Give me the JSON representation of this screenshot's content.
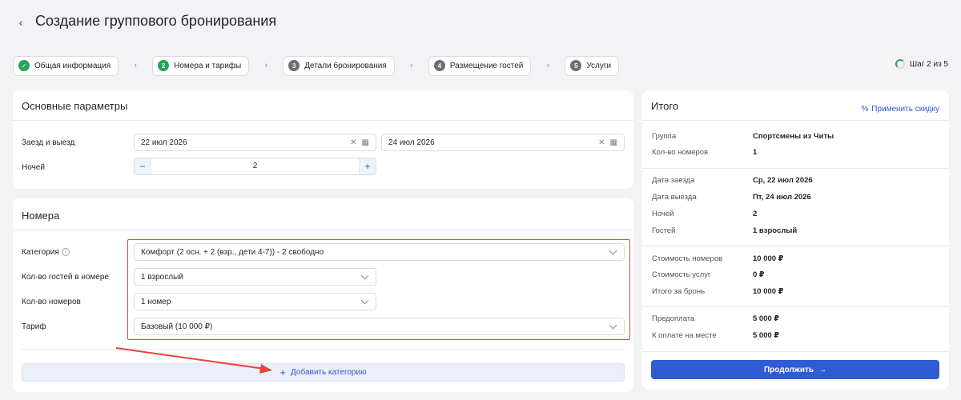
{
  "header": {
    "title": "Создание группового бронирования"
  },
  "steps": [
    {
      "num": "✓",
      "label": "Общая информация"
    },
    {
      "num": "2",
      "label": "Номера и тарифы"
    },
    {
      "num": "3",
      "label": "Детали бронирования"
    },
    {
      "num": "4",
      "label": "Размещение гостей"
    },
    {
      "num": "5",
      "label": "Услуги"
    }
  ],
  "step_counter": "Шаг 2 из 5",
  "params": {
    "title": "Основные параметры",
    "dates_label": "Заезд и выезд",
    "checkin": "22 июл 2026",
    "checkout": "24 июл 2026",
    "nights_label": "Ночей",
    "nights": "2"
  },
  "rooms": {
    "title": "Номера",
    "category_label": "Категория",
    "category_value": "Комфорт (2 осн. + 2 (взр., дети 4-7)) - 2 свободно",
    "guests_label": "Кол-во гостей в номере",
    "guests_value": "1 взрослый",
    "rooms_label": "Кол-во номеров",
    "rooms_value": "1 номер",
    "tariff_label": "Тариф",
    "tariff_value": "Базовый (10 000 ₽)",
    "add_category": "Добавить категорию"
  },
  "summary": {
    "title": "Итого",
    "apply_discount": "Применить скидку",
    "rows": [
      {
        "label": "Группа",
        "value": "Спортсмены из Читы"
      },
      {
        "label": "Кол-во номеров",
        "value": "1"
      },
      {
        "label": "Дата заезда",
        "value": "Ср, 22 июл 2026"
      },
      {
        "label": "Дата выезда",
        "value": "Пт, 24 июл 2026"
      },
      {
        "label": "Ночей",
        "value": "2"
      },
      {
        "label": "Гостей",
        "value": "1 взрослый"
      },
      {
        "label": "Стоимость номеров",
        "value": "10 000 ₽"
      },
      {
        "label": "Стоимость услуг",
        "value": "0 ₽"
      },
      {
        "label": "Итого за бронь",
        "value": "10 000 ₽"
      },
      {
        "label": "Предоплата",
        "value": "5 000 ₽"
      },
      {
        "label": "К оплате на месте",
        "value": "5 000 ₽"
      }
    ],
    "continue": "Продолжить"
  }
}
